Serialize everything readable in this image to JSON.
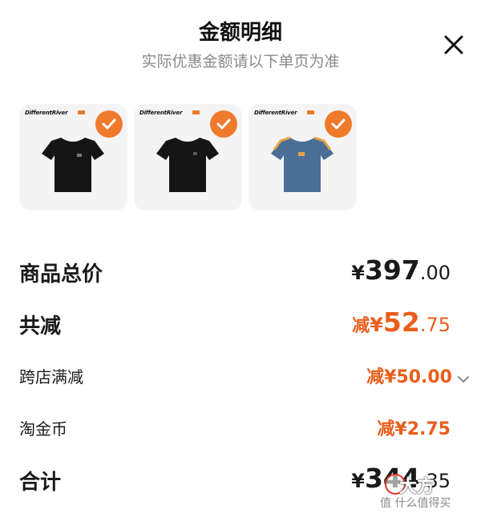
{
  "header": {
    "title": "金额明细",
    "subtitle": "实际优惠金额请以下单页为准",
    "close_icon": "close-icon"
  },
  "products": [
    {
      "brand": "DifferentRiver",
      "shirt_color": "#151515",
      "selected": true
    },
    {
      "brand": "DifferentRiver",
      "shirt_color": "#151515",
      "selected": true
    },
    {
      "brand": "DifferentRiver",
      "shirt_color": "#4a6e96",
      "selected": true
    }
  ],
  "rows": {
    "total": {
      "label": "商品总价",
      "symbol": "¥",
      "int": "397",
      "dec": ".00"
    },
    "discount": {
      "label": "共减",
      "prefix": "减",
      "symbol": "¥",
      "int": "52",
      "dec": ".75"
    },
    "cross_store": {
      "label": "跨店满减",
      "value": "减¥50.00"
    },
    "coins": {
      "label": "淘金币",
      "value": "减¥2.75"
    },
    "sum": {
      "label": "合计",
      "symbol": "¥",
      "int": "344",
      "dec": ".35"
    }
  },
  "watermark": {
    "big": "大方",
    "small": "值 什么值得买"
  },
  "colors": {
    "accent": "#ef7a2c",
    "discount": "#e95e1b",
    "muted": "#8a8a8a"
  }
}
